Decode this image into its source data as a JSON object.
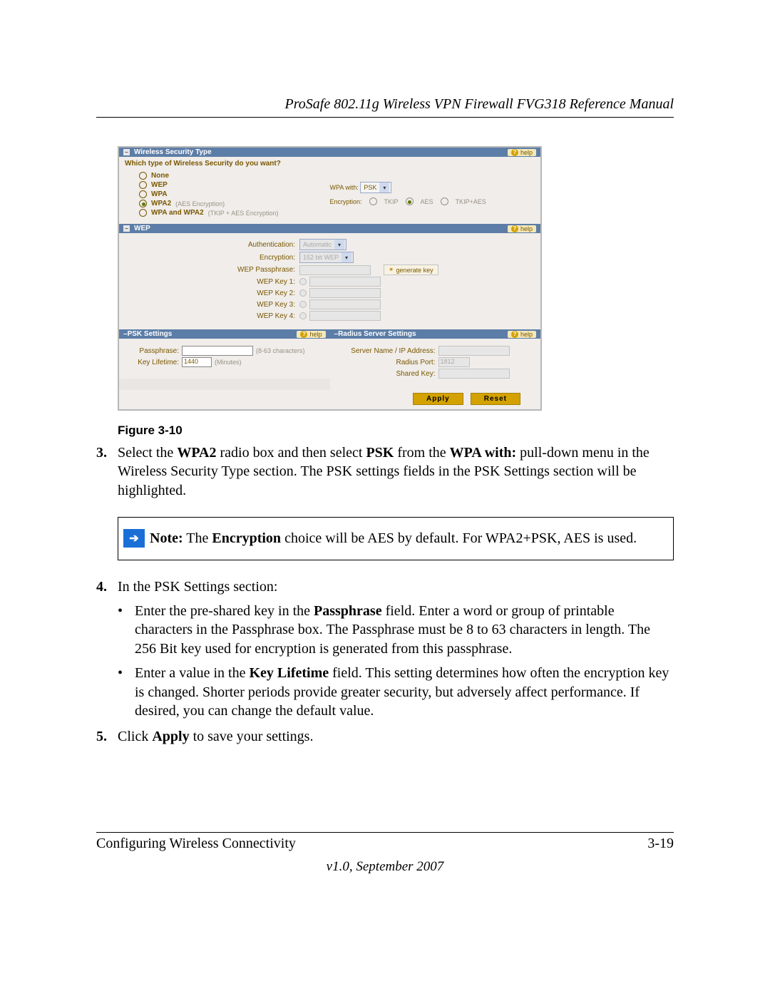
{
  "header": {
    "title": "ProSafe 802.11g Wireless VPN Firewall FVG318 Reference Manual"
  },
  "ui": {
    "wst": {
      "bar": "Wireless Security Type",
      "help": "help",
      "question": "Which type of Wireless Security do you want?",
      "opts": {
        "none": "None",
        "wep": "WEP",
        "wpa": "WPA",
        "wpa2": "WPA2",
        "wpa2_sub": "(AES Encryption)",
        "both": "WPA and WPA2",
        "both_sub": "(TKIP + AES Encryption)"
      },
      "wpa_with_label": "WPA with:",
      "wpa_with_value": "PSK",
      "enc_label": "Encryption:",
      "enc_tkip": "TKIP",
      "enc_aes": "AES",
      "enc_both": "TKIP+AES"
    },
    "wep": {
      "bar": "WEP",
      "auth_label": "Authentication:",
      "auth_value": "Automatic",
      "enc_label": "Encryption:",
      "enc_value": "152 bit WEP",
      "pass_label": "WEP Passphrase:",
      "gen_btn": "generate key",
      "k1": "WEP Key 1:",
      "k2": "WEP Key 2:",
      "k3": "WEP Key 3:",
      "k4": "WEP Key 4:"
    },
    "psk": {
      "bar": "PSK Settings",
      "pass_label": "Passphrase:",
      "pass_hint": "(8-63 characters)",
      "life_label": "Key Lifetime:",
      "life_value": "1440",
      "life_hint": "(Minutes)"
    },
    "radius": {
      "bar": "Radius Server Settings",
      "server_label": "Server Name / IP Address:",
      "port_label": "Radius Port:",
      "port_value": "1812",
      "key_label": "Shared Key:"
    },
    "buttons": {
      "apply": "Apply",
      "reset": "Reset"
    }
  },
  "figure_caption": "Figure 3-10",
  "step3": {
    "n": "3.",
    "p1a": "Select the ",
    "p1b": "WPA2",
    "p1c": " radio box and then select ",
    "p1d": "PSK",
    "p1e": " from the ",
    "p1f": "WPA with:",
    "p1g": " pull-down menu in the Wireless Security Type section. The PSK settings fields in the PSK Settings section will be highlighted."
  },
  "note": {
    "a": "Note:",
    "b": " The ",
    "c": "Encryption",
    "d": " choice will be AES by default. For WPA2+PSK, AES is used."
  },
  "step4": {
    "n": "4.",
    "intro": "In the PSK Settings section:",
    "b1a": "Enter the pre-shared key in the ",
    "b1b": "Passphrase",
    "b1c": " field. Enter a word or group of printable characters in the Passphrase box. The Passphrase must be 8 to 63 characters in length. The 256 Bit key used for encryption is generated from this passphrase.",
    "b2a": "Enter a value in the ",
    "b2b": "Key Lifetime",
    "b2c": " field. This setting determines how often the encryption key is changed. Shorter periods provide greater security, but adversely affect performance. If desired, you can change the default value."
  },
  "step5": {
    "n": "5.",
    "a": "Click ",
    "b": "Apply",
    "c": " to save your settings."
  },
  "footer": {
    "left": "Configuring Wireless Connectivity",
    "right": "3-19",
    "version": "v1.0, September 2007"
  }
}
